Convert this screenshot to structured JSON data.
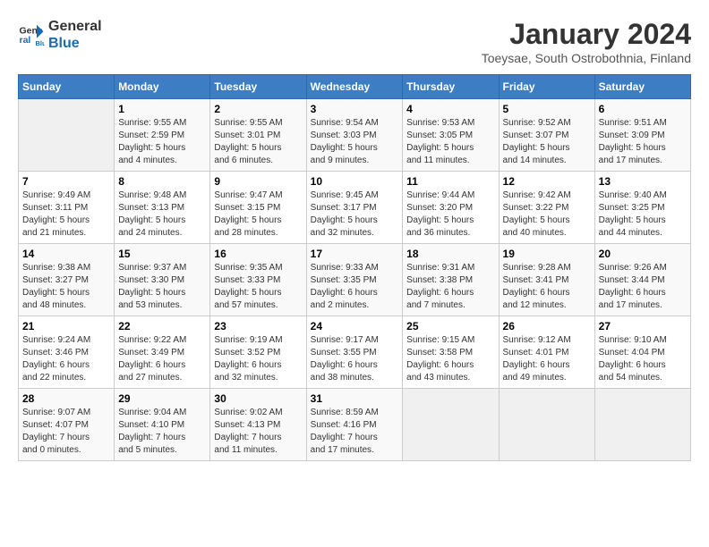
{
  "logo": {
    "line1": "General",
    "line2": "Blue"
  },
  "title": "January 2024",
  "subtitle": "Toeysae, South Ostrobothnia, Finland",
  "header": {
    "days": [
      "Sunday",
      "Monday",
      "Tuesday",
      "Wednesday",
      "Thursday",
      "Friday",
      "Saturday"
    ]
  },
  "weeks": [
    [
      {
        "day": "",
        "info": ""
      },
      {
        "day": "1",
        "info": "Sunrise: 9:55 AM\nSunset: 2:59 PM\nDaylight: 5 hours\nand 4 minutes."
      },
      {
        "day": "2",
        "info": "Sunrise: 9:55 AM\nSunset: 3:01 PM\nDaylight: 5 hours\nand 6 minutes."
      },
      {
        "day": "3",
        "info": "Sunrise: 9:54 AM\nSunset: 3:03 PM\nDaylight: 5 hours\nand 9 minutes."
      },
      {
        "day": "4",
        "info": "Sunrise: 9:53 AM\nSunset: 3:05 PM\nDaylight: 5 hours\nand 11 minutes."
      },
      {
        "day": "5",
        "info": "Sunrise: 9:52 AM\nSunset: 3:07 PM\nDaylight: 5 hours\nand 14 minutes."
      },
      {
        "day": "6",
        "info": "Sunrise: 9:51 AM\nSunset: 3:09 PM\nDaylight: 5 hours\nand 17 minutes."
      }
    ],
    [
      {
        "day": "7",
        "info": "Sunrise: 9:49 AM\nSunset: 3:11 PM\nDaylight: 5 hours\nand 21 minutes."
      },
      {
        "day": "8",
        "info": "Sunrise: 9:48 AM\nSunset: 3:13 PM\nDaylight: 5 hours\nand 24 minutes."
      },
      {
        "day": "9",
        "info": "Sunrise: 9:47 AM\nSunset: 3:15 PM\nDaylight: 5 hours\nand 28 minutes."
      },
      {
        "day": "10",
        "info": "Sunrise: 9:45 AM\nSunset: 3:17 PM\nDaylight: 5 hours\nand 32 minutes."
      },
      {
        "day": "11",
        "info": "Sunrise: 9:44 AM\nSunset: 3:20 PM\nDaylight: 5 hours\nand 36 minutes."
      },
      {
        "day": "12",
        "info": "Sunrise: 9:42 AM\nSunset: 3:22 PM\nDaylight: 5 hours\nand 40 minutes."
      },
      {
        "day": "13",
        "info": "Sunrise: 9:40 AM\nSunset: 3:25 PM\nDaylight: 5 hours\nand 44 minutes."
      }
    ],
    [
      {
        "day": "14",
        "info": "Sunrise: 9:38 AM\nSunset: 3:27 PM\nDaylight: 5 hours\nand 48 minutes."
      },
      {
        "day": "15",
        "info": "Sunrise: 9:37 AM\nSunset: 3:30 PM\nDaylight: 5 hours\nand 53 minutes."
      },
      {
        "day": "16",
        "info": "Sunrise: 9:35 AM\nSunset: 3:33 PM\nDaylight: 5 hours\nand 57 minutes."
      },
      {
        "day": "17",
        "info": "Sunrise: 9:33 AM\nSunset: 3:35 PM\nDaylight: 6 hours\nand 2 minutes."
      },
      {
        "day": "18",
        "info": "Sunrise: 9:31 AM\nSunset: 3:38 PM\nDaylight: 6 hours\nand 7 minutes."
      },
      {
        "day": "19",
        "info": "Sunrise: 9:28 AM\nSunset: 3:41 PM\nDaylight: 6 hours\nand 12 minutes."
      },
      {
        "day": "20",
        "info": "Sunrise: 9:26 AM\nSunset: 3:44 PM\nDaylight: 6 hours\nand 17 minutes."
      }
    ],
    [
      {
        "day": "21",
        "info": "Sunrise: 9:24 AM\nSunset: 3:46 PM\nDaylight: 6 hours\nand 22 minutes."
      },
      {
        "day": "22",
        "info": "Sunrise: 9:22 AM\nSunset: 3:49 PM\nDaylight: 6 hours\nand 27 minutes."
      },
      {
        "day": "23",
        "info": "Sunrise: 9:19 AM\nSunset: 3:52 PM\nDaylight: 6 hours\nand 32 minutes."
      },
      {
        "day": "24",
        "info": "Sunrise: 9:17 AM\nSunset: 3:55 PM\nDaylight: 6 hours\nand 38 minutes."
      },
      {
        "day": "25",
        "info": "Sunrise: 9:15 AM\nSunset: 3:58 PM\nDaylight: 6 hours\nand 43 minutes."
      },
      {
        "day": "26",
        "info": "Sunrise: 9:12 AM\nSunset: 4:01 PM\nDaylight: 6 hours\nand 49 minutes."
      },
      {
        "day": "27",
        "info": "Sunrise: 9:10 AM\nSunset: 4:04 PM\nDaylight: 6 hours\nand 54 minutes."
      }
    ],
    [
      {
        "day": "28",
        "info": "Sunrise: 9:07 AM\nSunset: 4:07 PM\nDaylight: 7 hours\nand 0 minutes."
      },
      {
        "day": "29",
        "info": "Sunrise: 9:04 AM\nSunset: 4:10 PM\nDaylight: 7 hours\nand 5 minutes."
      },
      {
        "day": "30",
        "info": "Sunrise: 9:02 AM\nSunset: 4:13 PM\nDaylight: 7 hours\nand 11 minutes."
      },
      {
        "day": "31",
        "info": "Sunrise: 8:59 AM\nSunset: 4:16 PM\nDaylight: 7 hours\nand 17 minutes."
      },
      {
        "day": "",
        "info": ""
      },
      {
        "day": "",
        "info": ""
      },
      {
        "day": "",
        "info": ""
      }
    ]
  ]
}
